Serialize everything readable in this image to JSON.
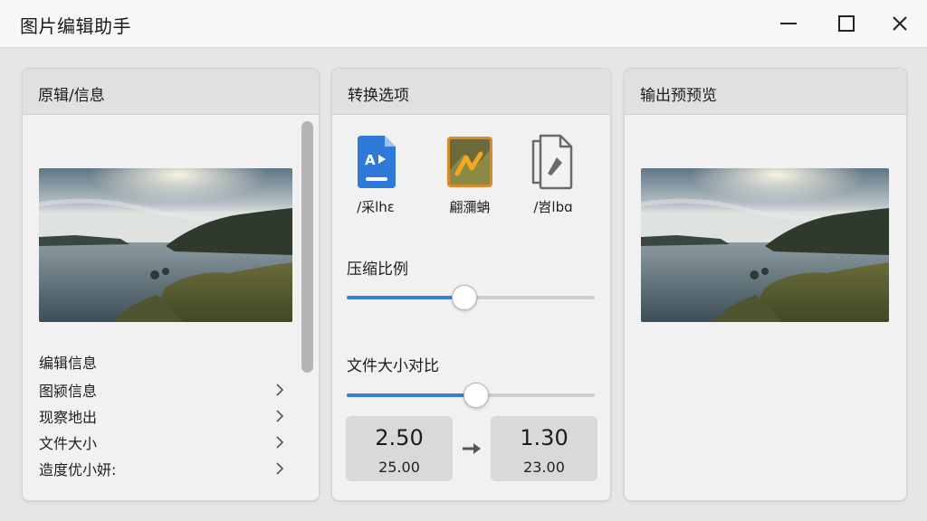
{
  "window": {
    "title": "图片编辑助手",
    "controls": [
      "minimize",
      "maximize",
      "close"
    ]
  },
  "left_panel": {
    "title": "原辑/信息",
    "info_heading": "编辑信息",
    "rows": [
      {
        "label": "图颍信息"
      },
      {
        "label": "现察地出"
      },
      {
        "label": "文件大小"
      },
      {
        "label": "造度优小妍:"
      }
    ]
  },
  "middle_panel": {
    "title": "转换选项",
    "formats": [
      {
        "label": "/采lhɛ",
        "icon": "document-image-icon"
      },
      {
        "label": "翩瀰蚺",
        "icon": "image-thumbnail-icon"
      },
      {
        "label": "/岧lbɑ",
        "icon": "files-copy-icon"
      }
    ],
    "compression": {
      "label": "压缩比例",
      "value_fraction": 0.47
    },
    "size_compare": {
      "label": "文件大小对比",
      "value_fraction": 0.52,
      "before": {
        "main": "2.50",
        "sub": "25.00"
      },
      "after": {
        "main": "1.30",
        "sub": "23.00"
      }
    }
  },
  "right_panel": {
    "title": "输出预预览"
  },
  "colors": {
    "accent": "#3b7fd4",
    "panel_bg": "#f1f1f1",
    "header_bg": "#e0e0e0",
    "titlebar_bg": "#f7f7f7"
  }
}
